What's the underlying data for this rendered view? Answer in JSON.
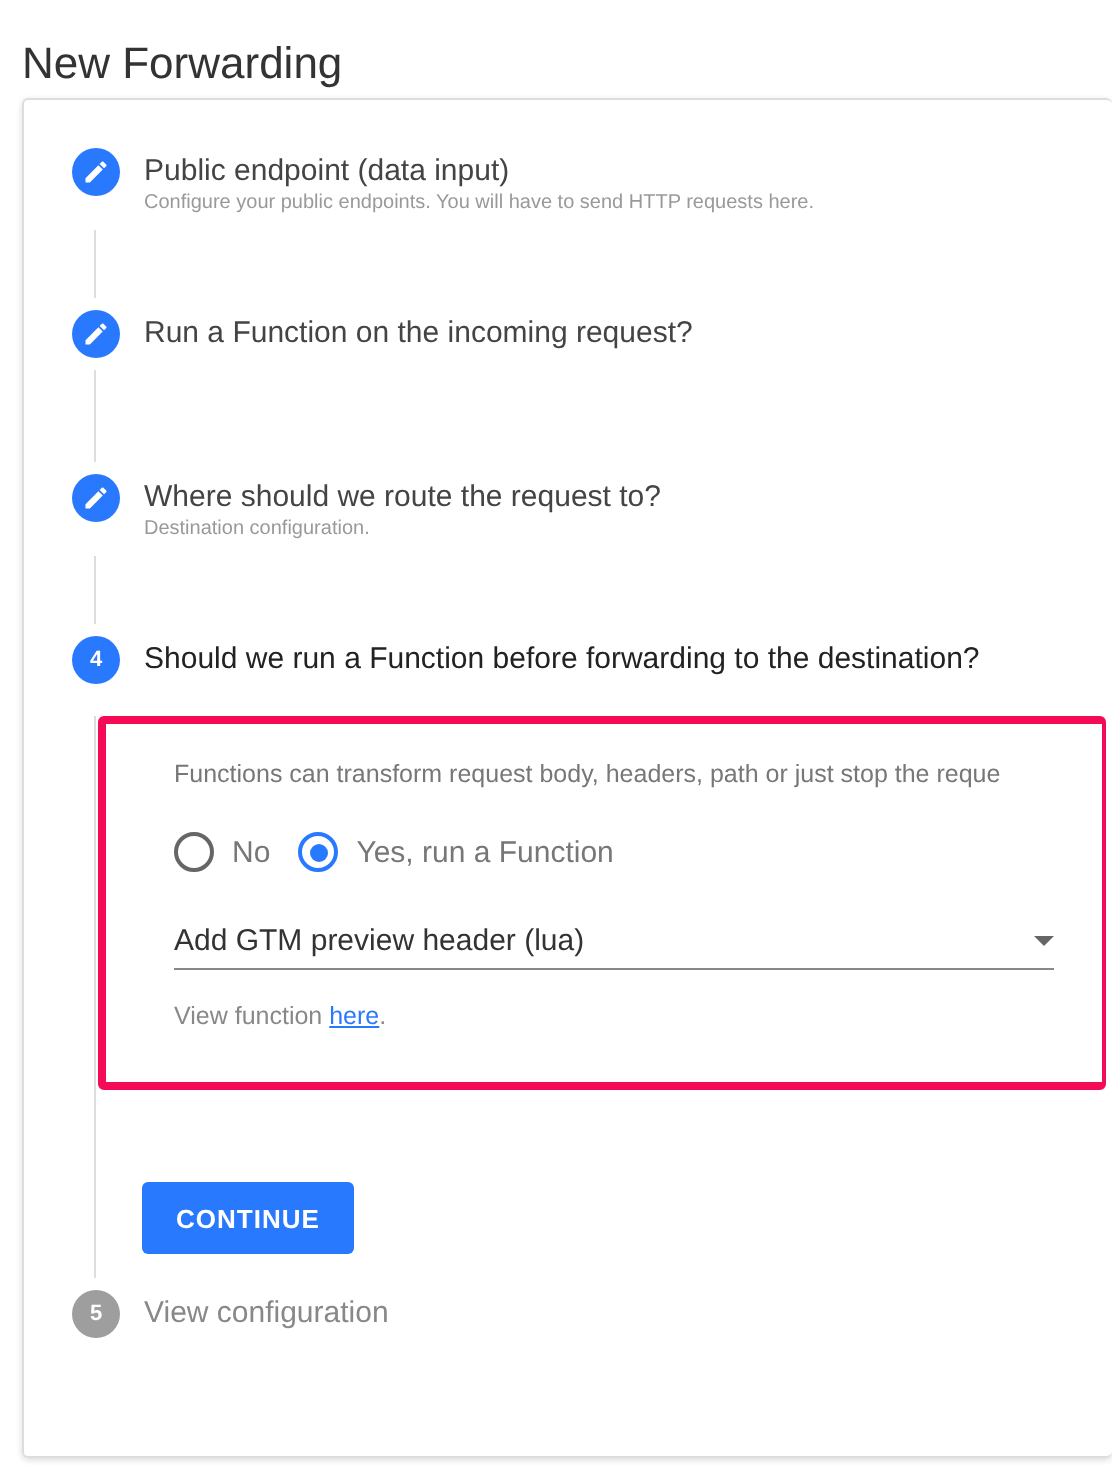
{
  "page": {
    "title": "New Forwarding"
  },
  "steps": [
    {
      "kind": "done",
      "title": "Public endpoint (data input)",
      "subtitle": "Configure your public endpoints. You will have to send HTTP requests here."
    },
    {
      "kind": "done",
      "title": "Run a Function on the incoming request?"
    },
    {
      "kind": "done",
      "title": "Where should we route the request to?",
      "subtitle": "Destination configuration."
    },
    {
      "kind": "active",
      "marker": "4",
      "title": "Should we run a Function before forwarding to the destination?"
    },
    {
      "kind": "pending",
      "marker": "5",
      "title": "View configuration"
    }
  ],
  "function_panel": {
    "description": "Functions can transform request body, headers, path or just stop the reque",
    "options": [
      {
        "label": "No",
        "selected": false
      },
      {
        "label": "Yes, run a Function",
        "selected": true
      }
    ],
    "select": {
      "value": "Add GTM preview header (lua)"
    },
    "hint": {
      "text": "View function ",
      "link": "here",
      "end": "."
    }
  },
  "continue_button": "CONTINUE"
}
